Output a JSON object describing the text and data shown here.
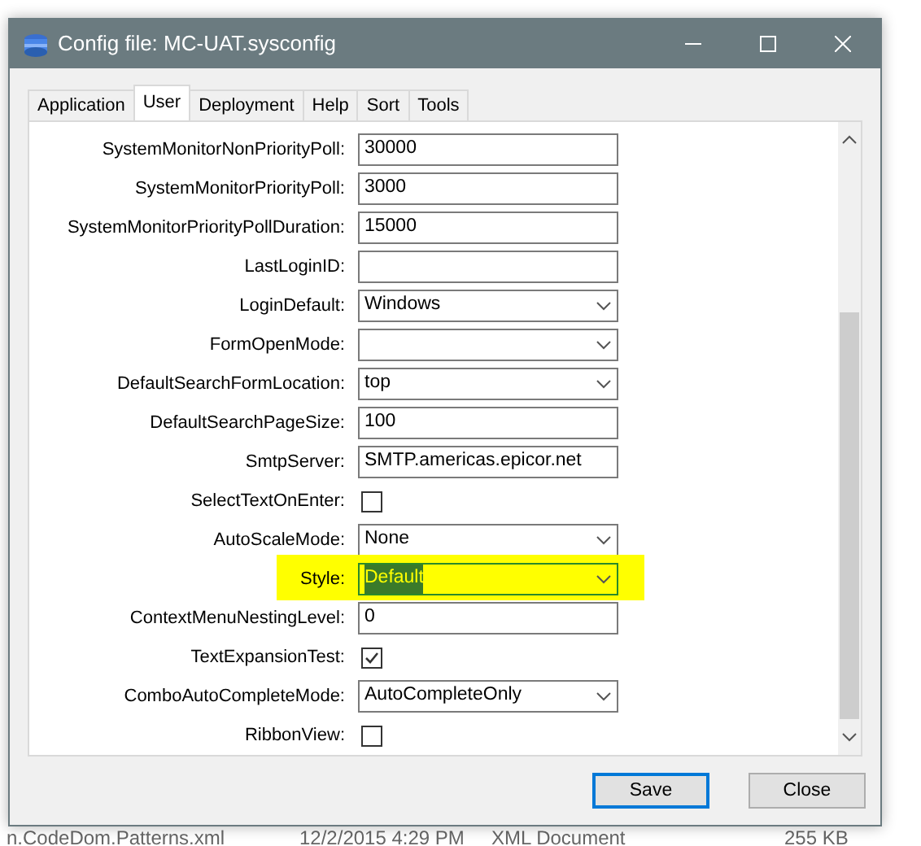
{
  "window": {
    "title": "Config file: MC-UAT.sysconfig"
  },
  "tabs": [
    {
      "label": "Application",
      "selected": false
    },
    {
      "label": "User",
      "selected": true
    },
    {
      "label": "Deployment",
      "selected": false
    },
    {
      "label": "Help",
      "selected": false
    },
    {
      "label": "Sort",
      "selected": false
    },
    {
      "label": "Tools",
      "selected": false
    }
  ],
  "settings": [
    {
      "label": "SystemMonitorNonPriorityPoll:",
      "kind": "text",
      "value": "30000",
      "highlighted": false
    },
    {
      "label": "SystemMonitorPriorityPoll:",
      "kind": "text",
      "value": "3000",
      "highlighted": false
    },
    {
      "label": "SystemMonitorPriorityPollDuration:",
      "kind": "text",
      "value": "15000",
      "highlighted": false
    },
    {
      "label": "LastLoginID:",
      "kind": "text",
      "highlighted": false
    },
    {
      "label": "LoginDefault:",
      "kind": "select",
      "value": "Windows",
      "highlighted": false
    },
    {
      "label": "FormOpenMode:",
      "kind": "select",
      "highlighted": false
    },
    {
      "label": "DefaultSearchFormLocation:",
      "kind": "select",
      "value": "top",
      "highlighted": false
    },
    {
      "label": "DefaultSearchPageSize:",
      "kind": "text",
      "value": "100",
      "highlighted": false
    },
    {
      "label": "SmtpServer:",
      "kind": "text",
      "value": "SMTP.americas.epicor.net",
      "highlighted": false
    },
    {
      "label": "SelectTextOnEnter:",
      "kind": "checkbox",
      "checked": false,
      "highlighted": false
    },
    {
      "label": "AutoScaleMode:",
      "kind": "select",
      "value": "None",
      "highlighted": false
    },
    {
      "label": "Style:",
      "kind": "select",
      "value": "Default",
      "highlighted": true
    },
    {
      "label": "ContextMenuNestingLevel:",
      "kind": "text",
      "value": "0",
      "highlighted": false
    },
    {
      "label": "TextExpansionTest:",
      "kind": "checkbox",
      "checked": true,
      "highlighted": false
    },
    {
      "label": "ComboAutoCompleteMode:",
      "kind": "select",
      "value": "AutoCompleteOnly",
      "highlighted": false
    },
    {
      "label": "RibbonView:",
      "kind": "checkbox",
      "checked": false,
      "highlighted": false
    }
  ],
  "buttons": [
    {
      "label": "Save",
      "default": true
    },
    {
      "label": "Close",
      "default": false
    }
  ],
  "background_row": {
    "name": "n.CodeDom.Patterns.xml",
    "date": "12/2/2015 4:29 PM",
    "type": "XML Document",
    "size": "255 KB"
  }
}
